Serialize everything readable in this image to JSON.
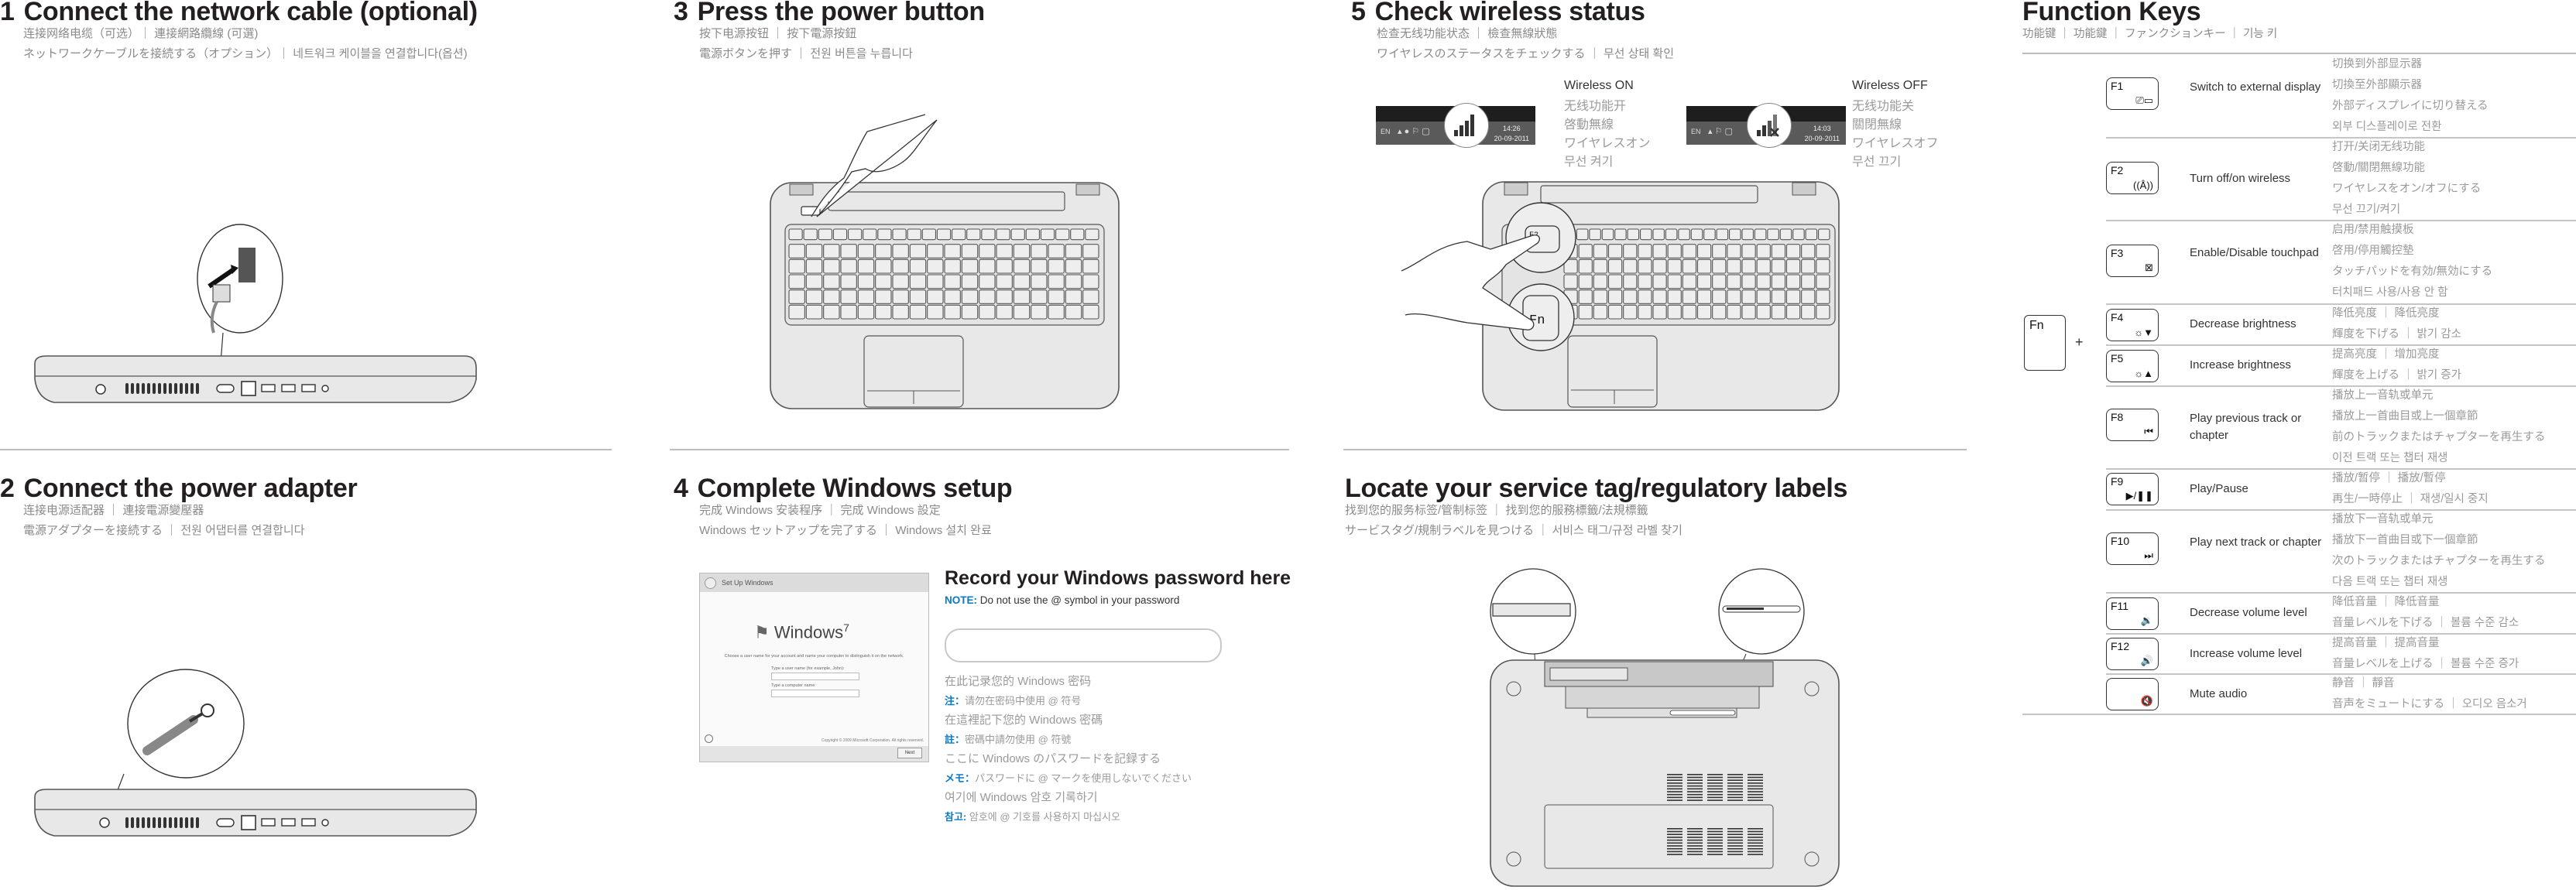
{
  "sections": {
    "network": {
      "number": "1",
      "title": "Connect the network cable (optional)",
      "sub1": "连接网络电缆（可选）｜ 連接網路纜線 (可選)",
      "sub2": "ネットワークケーブルを接続する（オプション）｜ 네트워크 케이블을 연결합니다(옵션)"
    },
    "power_adapter": {
      "number": "2",
      "title": "Connect the power adapter",
      "sub1": "连接电源适配器 ｜ 連接電源變壓器",
      "sub2": "電源アダプターを接続する ｜ 전원 어댑터를 연결합니다"
    },
    "power_button": {
      "number": "3",
      "title": "Press the power button",
      "sub1": "按下电源按钮 ｜ 按下電源按鈕",
      "sub2": "電源ボタンを押す ｜ 전원 버튼을 누릅니다"
    },
    "windows_setup": {
      "number": "4",
      "title": "Complete Windows setup",
      "sub1": "完成 Windows 安装程序 ｜ 完成 Windows 設定",
      "sub2": "Windows セットアップを完了する ｜ Windows 설치 완료",
      "screenshot": {
        "window_title": "Set Up Windows",
        "logo": "Windows",
        "logo_version": "7",
        "prompt": "Choose a user name for your account and name your computer to distinguish it on the network.",
        "user_label": "Type a user name (for example, John):",
        "computer_label": "Type a computer name:",
        "copyright": "Copyright © 2009 Microsoft Corporation. All rights reserved.",
        "next_button": "Next"
      },
      "password": {
        "title": "Record your Windows password here",
        "note_label": "NOTE:",
        "note_text": " Do not use the @ symbol in your password",
        "input_value": "",
        "lines": [
          {
            "label": "",
            "text": "在此记录您的 Windows 密码"
          },
          {
            "label": "注：",
            "text": "请勿在密码中使用 @ 符号"
          },
          {
            "label": "",
            "text": "在這裡記下您的 Windows 密碼"
          },
          {
            "label": "註：",
            "text": "密碼中請勿使用 @ 符號"
          },
          {
            "label": "",
            "text": "ここに Windows のパスワードを記録する"
          },
          {
            "label": "メモ：",
            "text": "パスワードに @ マークを使用しないでください"
          },
          {
            "label": "",
            "text": "여기에 Windows 암호 기록하기"
          },
          {
            "label": "참고:",
            "text": " 암호에 @ 기호를 사용하지 마십시오"
          }
        ]
      }
    },
    "wireless": {
      "number": "5",
      "title": "Check wireless status",
      "sub1": "检查无线功能状态 ｜ 檢查無線狀態",
      "sub2": "ワイヤレスのステータスをチェックする ｜ 무선 상태 확인",
      "on": {
        "label": "Wireless ON",
        "translations": [
          "无线功能开",
          "啓動無線",
          "ワイヤレスオン",
          "무선 켜기"
        ],
        "taskbar_lang": "EN",
        "time": "14:26",
        "date": "20-09-2011"
      },
      "off": {
        "label": "Wireless OFF",
        "translations": [
          "无线功能关",
          "關閉無線",
          "ワイヤレスオフ",
          "무선 끄기"
        ],
        "taskbar_lang": "EN",
        "time": "14:03",
        "date": "20-09-2011"
      },
      "fn_key_label": "Fn",
      "f2_key_label": "F2"
    },
    "service_tag": {
      "title": "Locate your service tag/regulatory labels",
      "sub1": "找到您的服务标签/管制标签 ｜ 找到您的服務標籤/法規標籤",
      "sub2": "サービスタグ/規制ラベルを見つける ｜ 서비스 태그/규정 라벨 찾기"
    }
  },
  "function_keys": {
    "title": "Function Keys",
    "subtitle": "功能键 ｜ 功能鍵 ｜ ファンクションキー ｜ 기능 키",
    "fn_label": "Fn",
    "plus": "+",
    "rows": [
      {
        "key": "F1",
        "icon": "display-switch-icon",
        "glyph": "⎚▭",
        "desc": "Switch to external display",
        "trans": [
          "切换到外部显示器",
          "切換至外部顯示器",
          "外部ディスプレイに切り替える",
          "외부 디스플레이로 전환"
        ]
      },
      {
        "key": "F2",
        "icon": "wireless-icon",
        "glyph": "((Å))",
        "desc": "Turn off/on wireless",
        "trans": [
          "打开/关闭无线功能",
          "啓動/關閉無線功能",
          "ワイヤレスをオン/オフにする",
          "무선 끄기/켜기"
        ]
      },
      {
        "key": "F3",
        "icon": "touchpad-icon",
        "glyph": "⊠",
        "desc": "Enable/Disable touchpad",
        "trans": [
          "启用/禁用触摸板",
          "啓用/停用觸控墊",
          "タッチパッドを有効/無効にする",
          "터치패드 사용/사용 안 함"
        ]
      },
      {
        "key": "F4",
        "icon": "brightness-down-icon",
        "glyph": "☼▼",
        "desc": "Decrease brightness",
        "trans": [
          "降低亮度 ｜ 降低亮度",
          "輝度を下げる ｜ 밝기 감소"
        ]
      },
      {
        "key": "F5",
        "icon": "brightness-up-icon",
        "glyph": "☼▲",
        "desc": "Increase brightness",
        "trans": [
          "提高亮度 ｜ 增加亮度",
          "輝度を上げる ｜ 밝기 증가"
        ]
      },
      {
        "key": "F8",
        "icon": "previous-track-icon",
        "glyph": "⏮",
        "desc": "Play previous track or chapter",
        "trans": [
          "播放上一音轨或单元",
          "播放上一首曲目或上一個章節",
          "前のトラックまたはチャプターを再生する",
          "이전 트랙 또는 챕터 재생"
        ]
      },
      {
        "key": "F9",
        "icon": "play-pause-icon",
        "glyph": "▶/❚❚",
        "desc": "Play/Pause",
        "trans": [
          "播放/暂停 ｜ 播放/暫停",
          "再生/一時停止 ｜ 재생/일시 중지"
        ]
      },
      {
        "key": "F10",
        "icon": "next-track-icon",
        "glyph": "⏭",
        "desc": "Play next track or chapter",
        "trans": [
          "播放下一音轨或单元",
          "播放下一首曲目或下一個章節",
          "次のトラックまたはチャプターを再生する",
          "다음 트랙 또는 챕터 재생"
        ]
      },
      {
        "key": "F11",
        "icon": "volume-down-icon",
        "glyph": "🔉",
        "desc": "Decrease volume level",
        "trans": [
          "降低音量 ｜ 降低音量",
          "音量レベルを下げる ｜ 볼륨 수준 감소"
        ]
      },
      {
        "key": "F12",
        "icon": "volume-up-icon",
        "glyph": "🔊",
        "desc": "Increase volume level",
        "trans": [
          "提高音量 ｜ 提高音量",
          "音量レベルを上げる ｜ 볼륨 수준 증가"
        ]
      },
      {
        "key": "",
        "icon": "mute-icon",
        "glyph": "🔇",
        "desc": "Mute audio",
        "trans": [
          "静音 ｜ 靜音",
          "音声をミュートにする ｜ 오디오 음소거"
        ]
      }
    ]
  },
  "colors": {
    "note_blue": "#0a7ac1",
    "heading": "#231f20",
    "translation_gray": "#9a9a9a"
  }
}
